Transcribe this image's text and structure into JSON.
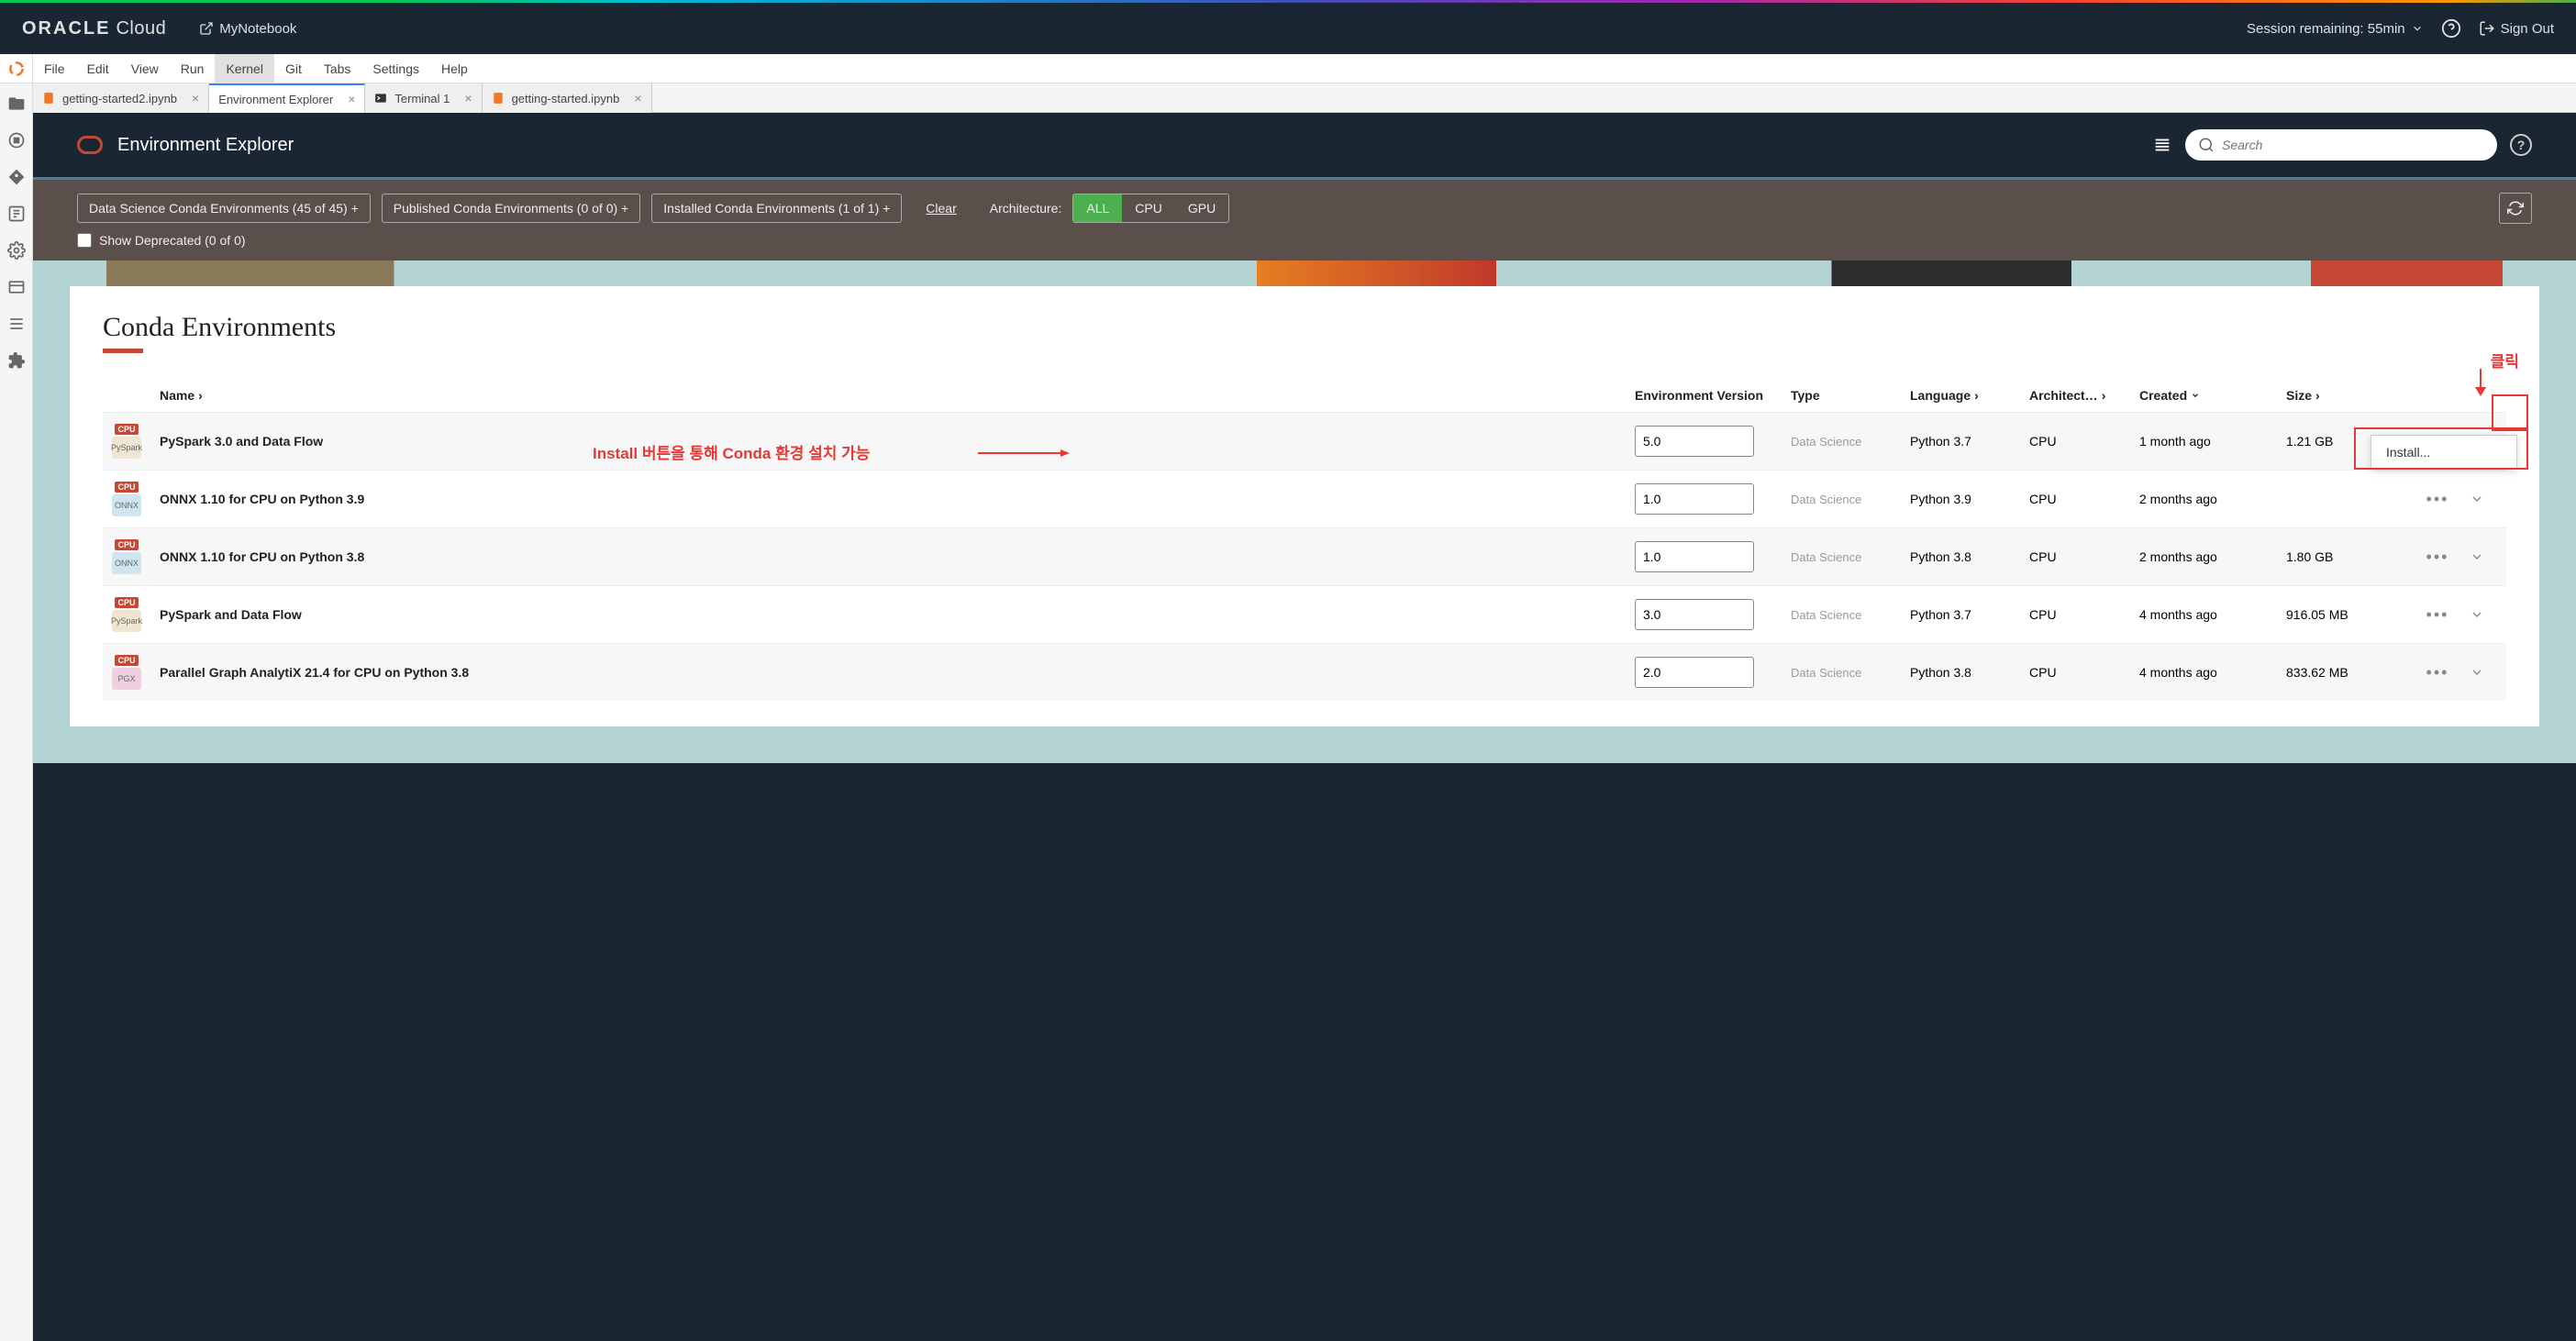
{
  "header": {
    "brand": "ORACLE",
    "brand_suffix": "Cloud",
    "notebook_link": "MyNotebook",
    "session_text": "Session remaining: 55min",
    "sign_out": "Sign Out"
  },
  "menubar": [
    "File",
    "Edit",
    "View",
    "Run",
    "Kernel",
    "Git",
    "Tabs",
    "Settings",
    "Help"
  ],
  "menubar_active_index": 4,
  "tabs": [
    {
      "label": "getting-started2.ipynb",
      "icon": "notebook",
      "active": false
    },
    {
      "label": "Environment Explorer",
      "icon": "none",
      "active": true
    },
    {
      "label": "Terminal 1",
      "icon": "terminal",
      "active": false
    },
    {
      "label": "getting-started.ipynb",
      "icon": "notebook",
      "active": false
    }
  ],
  "env_explorer": {
    "title": "Environment Explorer",
    "search_placeholder": "Search"
  },
  "filters": {
    "chips": [
      "Data Science Conda Environments (45 of 45)  +",
      "Published Conda Environments (0 of 0)  +",
      "Installed Conda Environments (1 of 1)  +"
    ],
    "clear": "Clear",
    "arch_label": "Architecture:",
    "arch_options": [
      "ALL",
      "CPU",
      "GPU"
    ],
    "arch_active": 0,
    "show_deprecated": "Show Deprecated (0 of 0)"
  },
  "section": {
    "title": "Conda Environments",
    "columns": {
      "name": "Name",
      "version": "Environment Version",
      "type": "Type",
      "language": "Language",
      "architecture": "Architect…",
      "created": "Created",
      "size": "Size"
    }
  },
  "rows": [
    {
      "icon": "PySpark",
      "icon_class": "",
      "name": "PySpark 3.0 and Data Flow",
      "version": "5.0",
      "type": "Data Science",
      "language": "Python 3.7",
      "arch": "CPU",
      "created": "1 month ago",
      "size": "1.21 GB"
    },
    {
      "icon": "ONNX",
      "icon_class": "onnx",
      "name": "ONNX 1.10 for CPU on Python 3.9",
      "version": "1.0",
      "type": "Data Science",
      "language": "Python 3.9",
      "arch": "CPU",
      "created": "2 months ago",
      "size": ""
    },
    {
      "icon": "ONNX",
      "icon_class": "onnx",
      "name": "ONNX 1.10 for CPU on Python 3.8",
      "version": "1.0",
      "type": "Data Science",
      "language": "Python 3.8",
      "arch": "CPU",
      "created": "2 months ago",
      "size": "1.80 GB"
    },
    {
      "icon": "PySpark",
      "icon_class": "",
      "name": "PySpark and Data Flow",
      "version": "3.0",
      "type": "Data Science",
      "language": "Python 3.7",
      "arch": "CPU",
      "created": "4 months ago",
      "size": "916.05 MB"
    },
    {
      "icon": "PGX",
      "icon_class": "pgx",
      "name": "Parallel Graph AnalytiX 21.4 for CPU on Python 3.8",
      "version": "2.0",
      "type": "Data Science",
      "language": "Python 3.8",
      "arch": "CPU",
      "created": "4 months ago",
      "size": "833.62 MB"
    }
  ],
  "popup": {
    "install": "Install..."
  },
  "annotations": {
    "click_label": "클릭",
    "install_text": "Install 버튼을 통해 Conda 환경 설치 가능"
  }
}
